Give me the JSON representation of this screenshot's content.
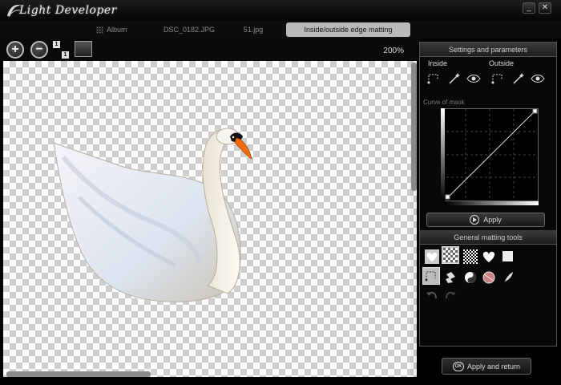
{
  "app": {
    "title": "Light Developer"
  },
  "window": {
    "minimize_glyph": "_",
    "close_glyph": "✕"
  },
  "tabs": [
    {
      "label": "Album",
      "icon": "grid-icon"
    },
    {
      "label": "DSC_0182.JPG"
    },
    {
      "label": "51.jpg"
    },
    {
      "label": "Inside/outside edge matting",
      "active": true
    }
  ],
  "toolbar": {
    "zoom_in_glyph": "+",
    "zoom_out_glyph": "−",
    "actual_size_a": "1",
    "actual_size_b": "1",
    "zoom_level": "200%"
  },
  "panel": {
    "settings_title": "Settings and parameters",
    "inside_label": "Inside",
    "outside_label": "Outside",
    "curve_label": "Curve of mask",
    "apply_label": "Apply",
    "general_title": "General matting tools"
  },
  "footer": {
    "ok_badge": "OK",
    "apply_return_label": "Apply and return"
  },
  "colors": {
    "accent": "#bdbdbd",
    "beak": "#f06b12"
  }
}
